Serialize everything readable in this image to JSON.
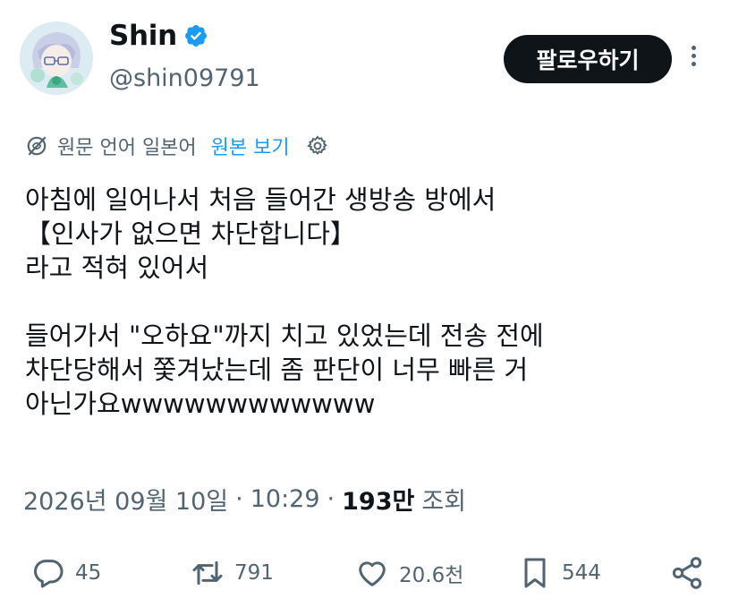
{
  "author": {
    "display_name": "Shin",
    "handle": "@shin09791",
    "verified": true
  },
  "header": {
    "follow_label": "팔로우하기"
  },
  "translation": {
    "note": "원문 언어 일본어",
    "show_original": "원본 보기"
  },
  "tweet": {
    "lines": [
      "아침에 일어나서 처음 들어간 생방송 방에서",
      "【인사가 없으면 차단합니다】",
      "라고 적혀 있어서",
      "",
      "들어가서 \"오하요\"까지 치고 있었는데 전송 전에",
      "차단당해서 쫓겨났는데 좀 판단이 너무 빠른 거",
      "아닌가요wwwwwwwwwwww"
    ]
  },
  "meta": {
    "date": "2026년 09월 10일",
    "time": "10:29",
    "views": "193만",
    "views_label": "조회"
  },
  "actions": {
    "replies": "45",
    "reposts": "791",
    "likes": "20.6천",
    "bookmarks": "544"
  },
  "colors": {
    "text": "#0f1419",
    "secondary": "#536471",
    "link": "#1d9bf0",
    "verified": "#1d9bf0"
  }
}
